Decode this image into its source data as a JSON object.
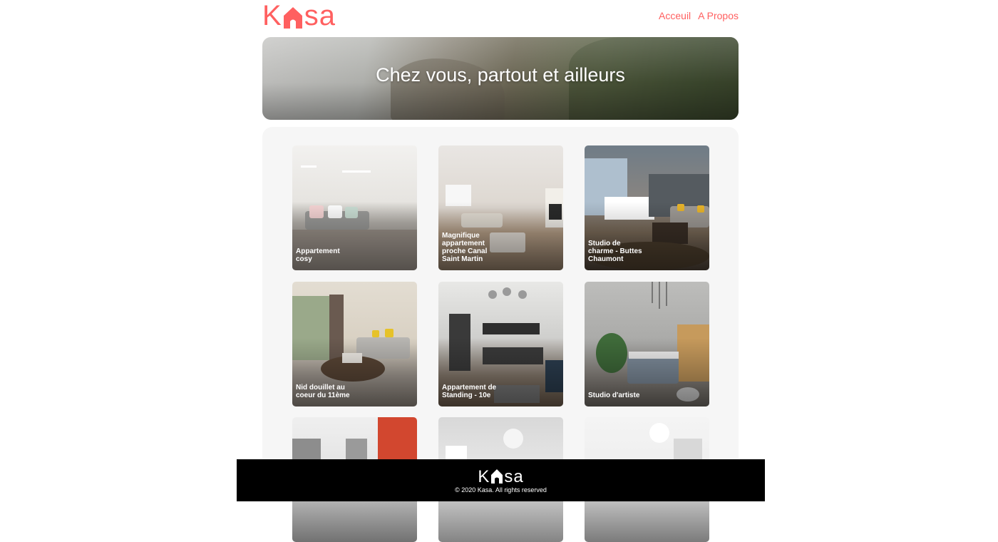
{
  "header": {
    "logo_left": "K",
    "logo_right": "sa",
    "nav": [
      {
        "label": "Acceuil"
      },
      {
        "label": "A Propos"
      }
    ]
  },
  "banner": {
    "title": "Chez vous, partout et ailleurs"
  },
  "gallery": {
    "cards": [
      {
        "title": "Appartement cosy"
      },
      {
        "title": "Magnifique appartement proche Canal Saint Martin"
      },
      {
        "title": "Studio de charme - Buttes Chaumont"
      },
      {
        "title": "Nid douillet au coeur du 11ème"
      },
      {
        "title": "Appartement de Standing - 10e"
      },
      {
        "title": "Studio d'artiste"
      },
      {
        "title": ""
      },
      {
        "title": ""
      },
      {
        "title": ""
      }
    ]
  },
  "footer": {
    "logo_left": "K",
    "logo_right": "sa",
    "copyright": "© 2020 Kasa. All rights reserved"
  },
  "colors": {
    "brand": "#FF6060",
    "gallery_bg": "#F6F6F6",
    "footer_bg": "#000000"
  }
}
